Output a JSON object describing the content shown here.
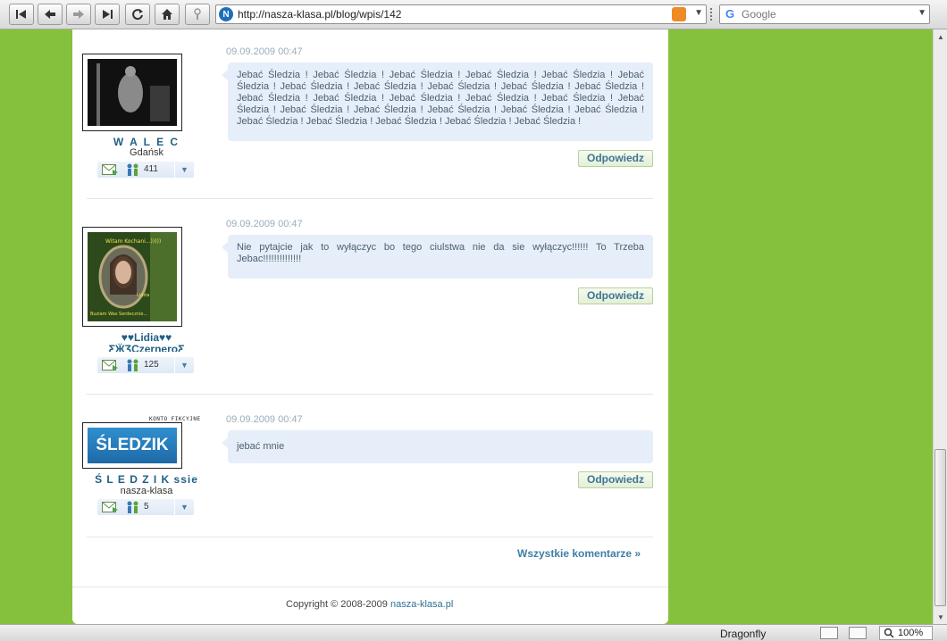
{
  "browser": {
    "url": "http://nasza-klasa.pl/blog/wpis/142",
    "search_placeholder": "Google",
    "status_text": "Dragonfly",
    "zoom": "100%"
  },
  "comments": [
    {
      "user_name": "W A L E C",
      "user_city": "Gdańsk",
      "friends_count": "411",
      "date": "09.09.2009 00:47",
      "text": "Jebać Śledzia ! Jebać Śledzia ! Jebać Śledzia ! Jebać Śledzia ! Jebać Śledzia ! Jebać Śledzia ! Jebać Śledzia ! Jebać Śledzia ! Jebać Śledzia ! Jebać Śledzia ! Jebać Śledzia ! Jebać Śledzia ! Jebać Śledzia ! Jebać Śledzia ! Jebać Śledzia ! Jebać Śledzia ! Jebać Śledzia ! Jebać Śledzia ! Jebać Śledzia ! Jebać Śledzia ! Jebać Śledzia ! Jebać Śledzia ! Jebać Śledzia ! Jebać Śledzia ! Jebać Śledzia ! Jebać Śledzia ! Jebać Śledzia !",
      "reply_label": "Odpowiedz"
    },
    {
      "user_name": "♥♥Lidia♥♥",
      "user_name_line2": "ƸӜƷCzerneroƸ",
      "friends_count": "125",
      "date": "09.09.2009 00:47",
      "text": "Nie pytajcie jak to wyłączyc bo tego ciulstwa nie da sie wyłączyc!!!!!! To Trzeba Jebac!!!!!!!!!!!!!!",
      "reply_label": "Odpowiedz",
      "avatar_caption_top": "Witam Kochani...)))))",
      "avatar_caption_mid": "Lidzia",
      "avatar_caption_bottom": "Buziam Was Serdecznie..."
    },
    {
      "user_name": "Ś L E D Z I K ssie",
      "user_city": "nasza-klasa",
      "friends_count": "5",
      "date": "09.09.2009 00:47",
      "text": "jebać mnie",
      "reply_label": "Odpowiedz",
      "fake_label": "KONTO FIKCYJNE",
      "avatar_logo": "ŚLEDZIK"
    }
  ],
  "all_comments_link": "Wszystkie komentarze »",
  "footer": {
    "copyright": "Copyright © 2008-2009",
    "site_link": "nasza-klasa.pl"
  }
}
